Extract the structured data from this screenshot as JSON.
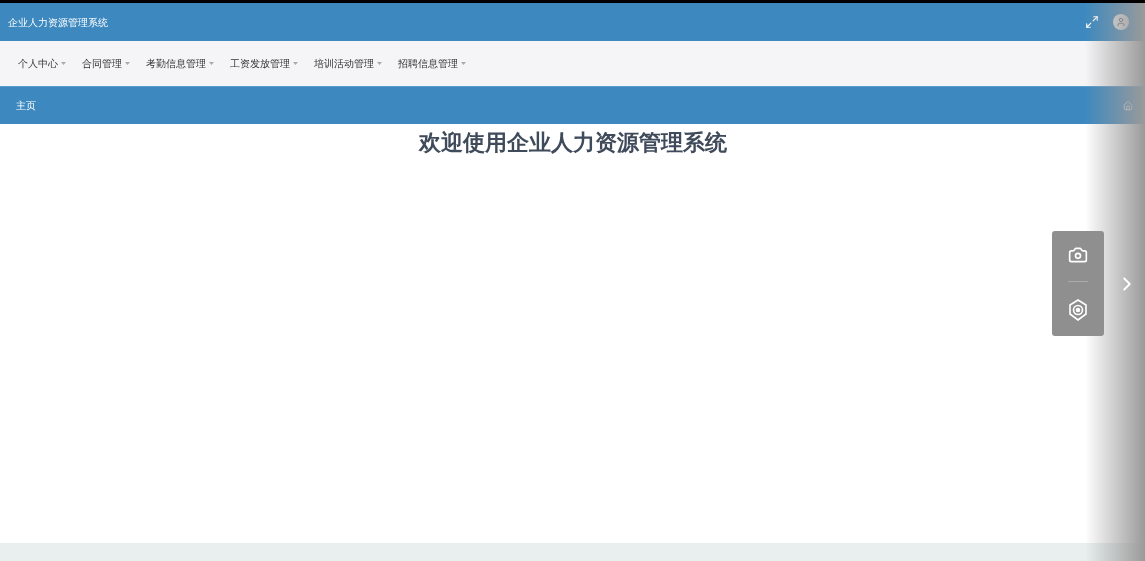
{
  "header": {
    "title": "企业人力资源管理系统"
  },
  "nav": {
    "items": [
      {
        "label": "个人中心"
      },
      {
        "label": "合同管理"
      },
      {
        "label": "考勤信息管理"
      },
      {
        "label": "工资发放管理"
      },
      {
        "label": "培训活动管理"
      },
      {
        "label": "招聘信息管理"
      }
    ]
  },
  "breadcrumb": {
    "label": "主页"
  },
  "main": {
    "heading": "欢迎使用企业人力资源管理系统"
  }
}
